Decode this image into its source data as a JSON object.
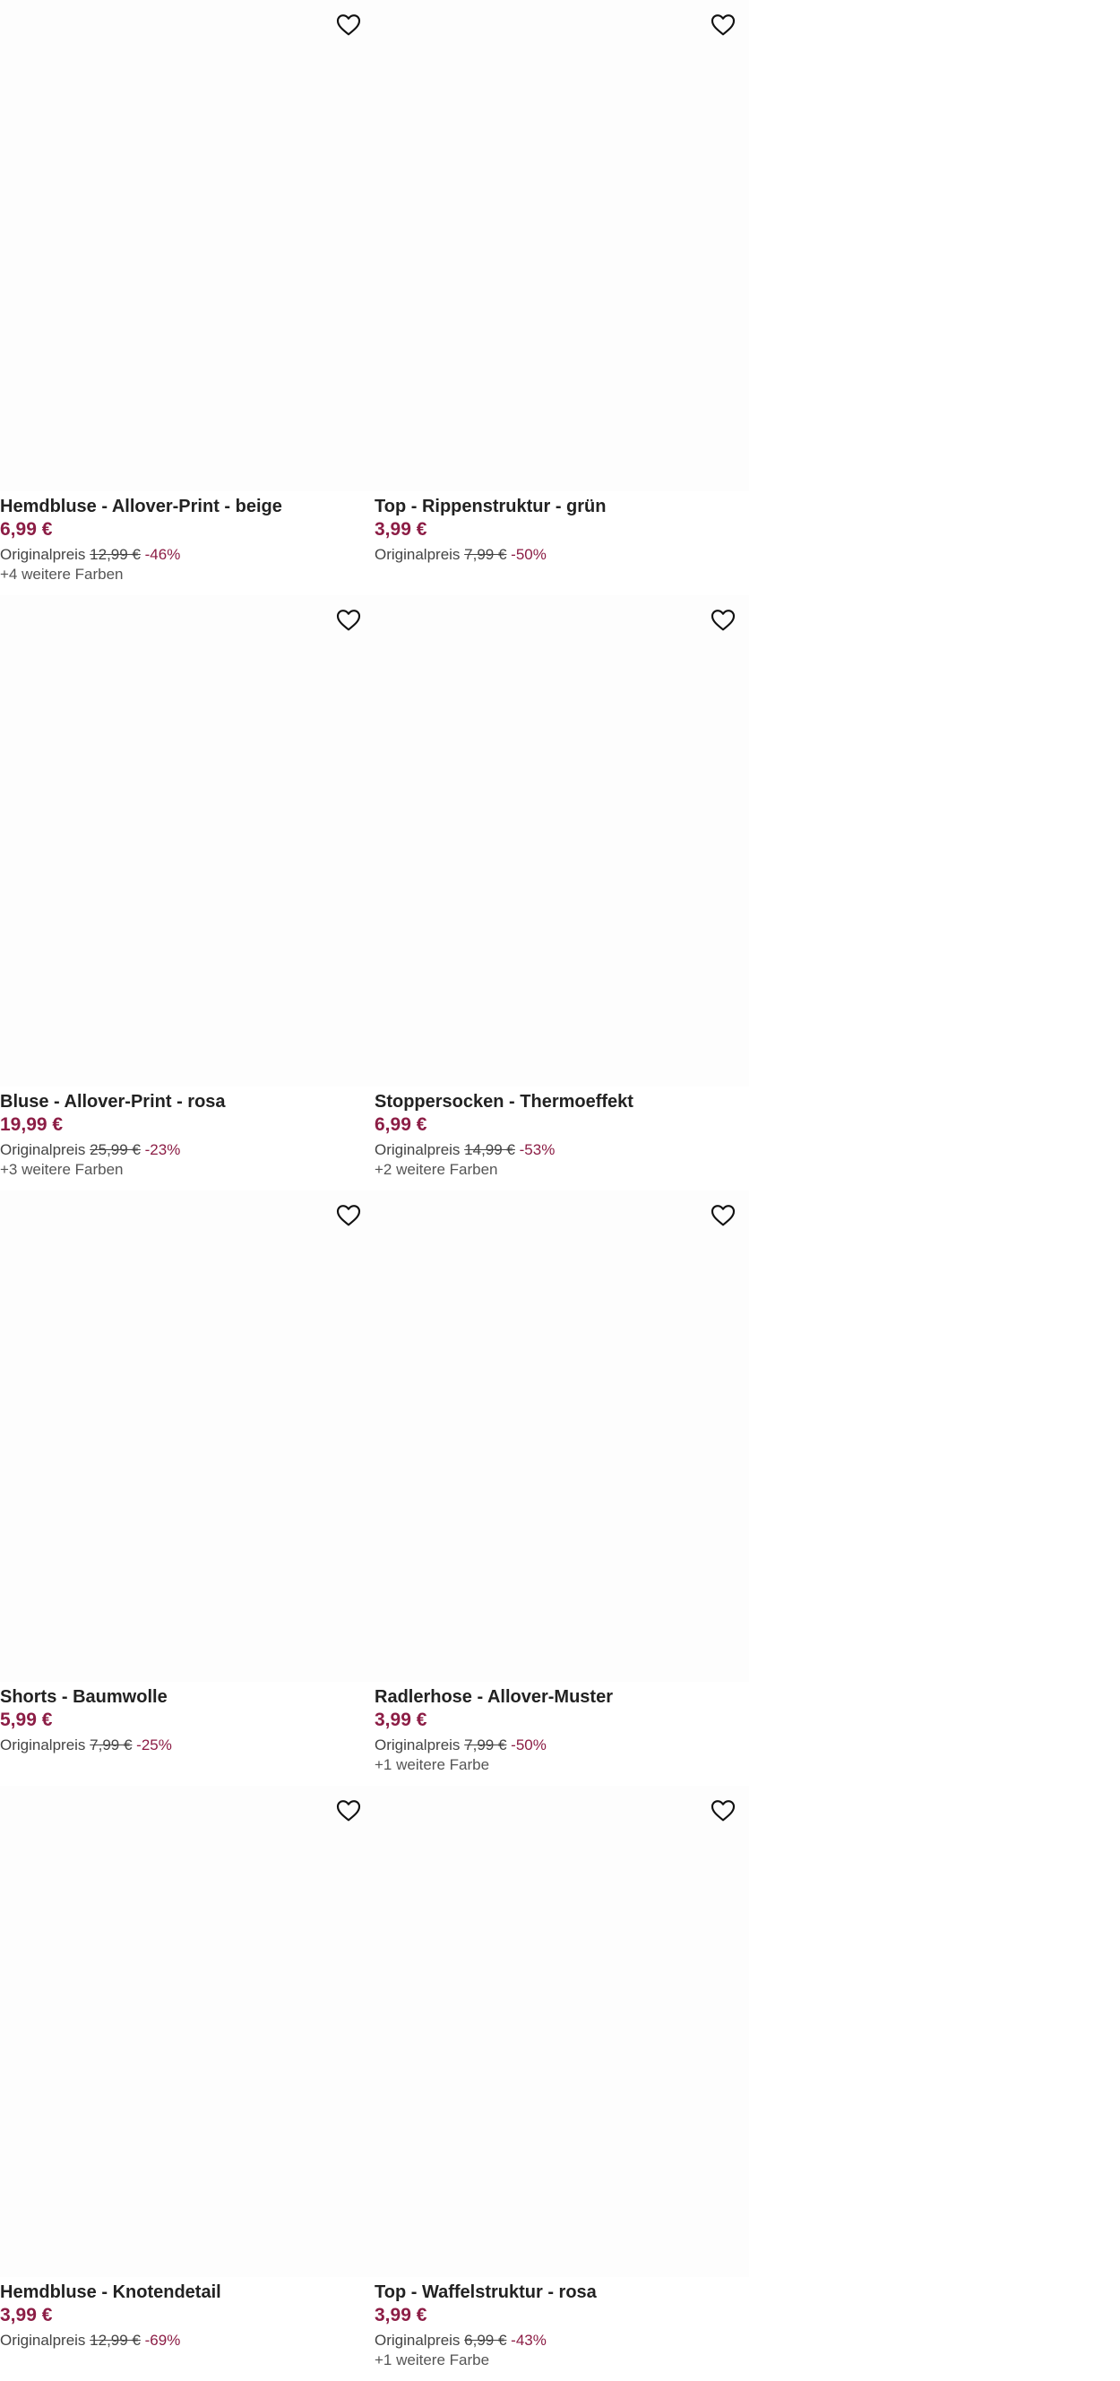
{
  "labels": {
    "original_price": "Originalpreis"
  },
  "colors": {
    "price": "#8c1d45",
    "text": "#222222",
    "image_bg": "#fdfdfd"
  },
  "products": [
    {
      "title": "Hemdbluse - Allover-Print - beige",
      "price": "6,99 €",
      "original_price": "12,99 €",
      "discount": "-46%",
      "more_colors": "+4 weitere Farben",
      "wishlist_icon": "heart-outline-icon"
    },
    {
      "title": "Top - Rippenstruktur - grün",
      "price": "3,99 €",
      "original_price": "7,99 €",
      "discount": "-50%",
      "more_colors": "",
      "wishlist_icon": "heart-outline-icon"
    },
    {
      "title": "Bluse - Allover-Print - rosa",
      "price": "19,99 €",
      "original_price": "25,99 €",
      "discount": "-23%",
      "more_colors": "+3 weitere Farben",
      "wishlist_icon": "heart-outline-icon"
    },
    {
      "title": "Stoppersocken - Thermoeffekt",
      "price": "6,99 €",
      "original_price": "14,99 €",
      "discount": "-53%",
      "more_colors": "+2 weitere Farben",
      "wishlist_icon": "heart-outline-icon"
    },
    {
      "title": "Shorts - Baumwolle",
      "price": "5,99 €",
      "original_price": "7,99 €",
      "discount": "-25%",
      "more_colors": "",
      "wishlist_icon": "heart-outline-icon"
    },
    {
      "title": "Radlerhose - Allover-Muster",
      "price": "3,99 €",
      "original_price": "7,99 €",
      "discount": "-50%",
      "more_colors": "+1 weitere Farbe",
      "wishlist_icon": "heart-outline-icon"
    },
    {
      "title": "Hemdbluse - Knotendetail",
      "price": "3,99 €",
      "original_price": "12,99 €",
      "discount": "-69%",
      "more_colors": "",
      "wishlist_icon": "heart-outline-icon"
    },
    {
      "title": "Top - Waffelstruktur - rosa",
      "price": "3,99 €",
      "original_price": "6,99 €",
      "discount": "-43%",
      "more_colors": "+1 weitere Farbe",
      "wishlist_icon": "heart-outline-icon"
    }
  ]
}
